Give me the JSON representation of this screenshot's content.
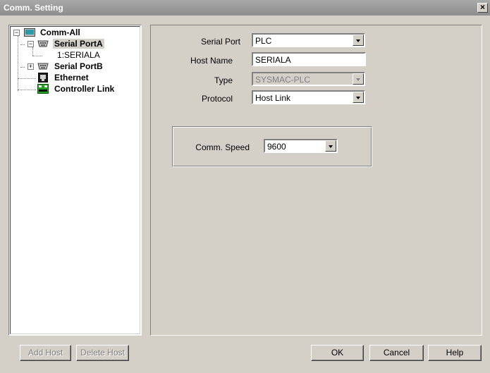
{
  "window": {
    "title": "Comm. Setting",
    "close_label": "×"
  },
  "tree": {
    "root": {
      "label": "Comm-All",
      "icon": "monitor-icon",
      "expander": "−"
    },
    "items": [
      {
        "label": "Serial PortA",
        "icon": "serial-port-icon",
        "expander": "−",
        "selected": true
      },
      {
        "label": "1:SERIALA"
      },
      {
        "label": "Serial PortB",
        "icon": "serial-port-icon",
        "expander": "+"
      },
      {
        "label": "Ethernet",
        "icon": "ethernet-icon"
      },
      {
        "label": "Controller Link",
        "icon": "controller-link-icon"
      }
    ]
  },
  "form": {
    "serial_port": {
      "label": "Serial Port",
      "value": "PLC"
    },
    "host_name": {
      "label": "Host Name",
      "value": "SERIALA"
    },
    "type": {
      "label": "Type",
      "value": "SYSMAC-PLC"
    },
    "protocol": {
      "label": "Protocol",
      "value": "Host Link"
    },
    "comm_speed": {
      "label": "Comm. Speed",
      "value": "9600"
    }
  },
  "buttons": {
    "add_host": "Add Host",
    "delete_host": "Delete Host",
    "ok": "OK",
    "cancel": "Cancel",
    "help": "Help"
  }
}
